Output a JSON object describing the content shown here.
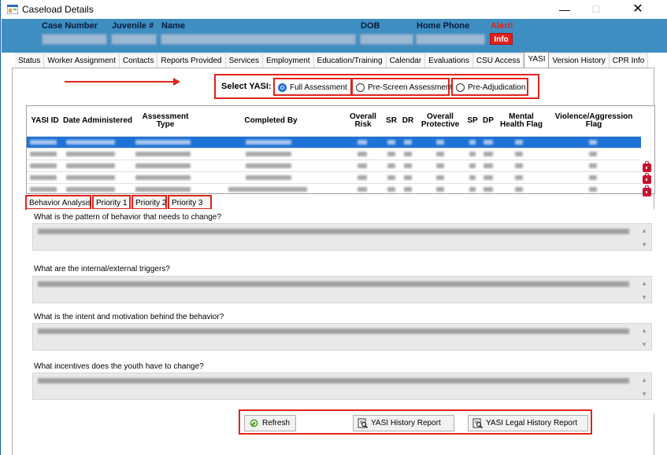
{
  "window": {
    "title": "Caseload Details",
    "minimize_glyph": "—",
    "maximize_glyph": "☐",
    "close_glyph": "✕"
  },
  "header": {
    "case_number_label": "Case Number",
    "juvenile_label": "Juvenile #",
    "name_label": "Name",
    "dob_label": "DOB",
    "phone_label": "Home Phone",
    "alert_label": "Alert!",
    "info_button": "Info",
    "band_color": "#3e8ec2",
    "alert_color": "#e0231b"
  },
  "tabs": [
    {
      "label": "Status"
    },
    {
      "label": "Worker Assignment"
    },
    {
      "label": "Contacts"
    },
    {
      "label": "Reports Provided"
    },
    {
      "label": "Services"
    },
    {
      "label": "Employment"
    },
    {
      "label": "Education/Training"
    },
    {
      "label": "Calendar"
    },
    {
      "label": "Evaluations"
    },
    {
      "label": "CSU Access"
    },
    {
      "label": "YASI"
    },
    {
      "label": "Version History"
    },
    {
      "label": "CPR Info"
    }
  ],
  "active_tab": "YASI",
  "select_yasi": {
    "label": "Select YASI:",
    "options": [
      {
        "label": "Full Assessment",
        "selected": true
      },
      {
        "label": "Pre-Screen Assessment",
        "selected": false
      },
      {
        "label": "Pre-Adjudication",
        "selected": false
      }
    ]
  },
  "grid": {
    "columns": [
      "YASI ID",
      "Date Administered",
      "Assessment Type",
      "Completed By",
      "Overall Risk",
      "SR",
      "DR",
      "Overall Protective",
      "SP",
      "DP",
      "Mental Health Flag",
      "Violence/Aggression Flag"
    ],
    "selection_color": "#1f72d6"
  },
  "subtabs": [
    {
      "label": "Behavior Analysis"
    },
    {
      "label": "Priority 1"
    },
    {
      "label": "Priority 2"
    },
    {
      "label": "Priority 3"
    }
  ],
  "questions": [
    {
      "label": "What is the pattern of behavior that needs to change?"
    },
    {
      "label": "What are the internal/external triggers?"
    },
    {
      "label": "What is the intent and motivation behind the behavior?"
    },
    {
      "label": "What incentives does the youth have to change?"
    }
  ],
  "buttons": {
    "refresh": "Refresh",
    "history_report": "YASI History Report",
    "legal_history_report": "YASI Legal History Report"
  },
  "icons": {
    "app": "app-window-icon",
    "lock": "lock-icon",
    "refresh": "refresh-icon",
    "report": "report-magnifier-icon"
  }
}
